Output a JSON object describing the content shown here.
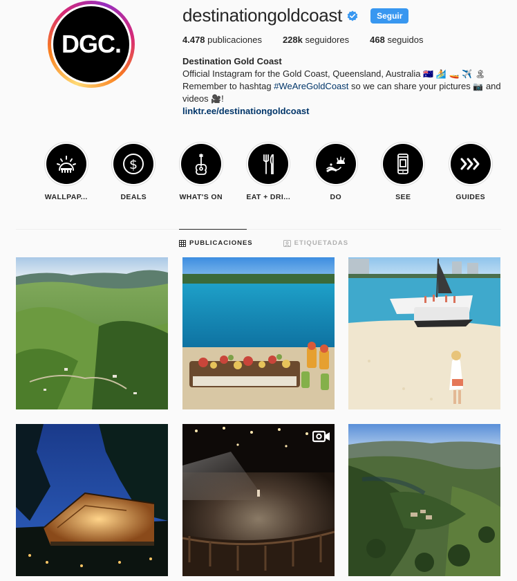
{
  "profile": {
    "avatar_text": "DGC.",
    "username": "destinationgoldcoast",
    "follow_label": "Seguir",
    "stats": {
      "posts_count": "4.478",
      "posts_label": "publicaciones",
      "followers_count": "228k",
      "followers_label": "seguidores",
      "following_count": "468",
      "following_label": "seguidos"
    },
    "bio": {
      "name": "Destination Gold Coast",
      "line1": "Official Instagram for the Gold Coast, Queensland, Australia",
      "line1_emojis": "🇦🇺 🏄 🚤 ✈️ 🏝",
      "line2_prefix": "Remember to hashtag",
      "hashtag": "#WeAreGoldCoast",
      "line2_suffix": "so we can share your pictures",
      "line2_emoji": "📷",
      "line2_end": "and",
      "line3": "videos",
      "line3_emoji": "🎥",
      "line3_end": "!",
      "link": "linktr.ee/destinationgoldcoast"
    }
  },
  "highlights": [
    {
      "label": "WALLPAP...",
      "icon": "sunrise-icon"
    },
    {
      "label": "DEALS",
      "icon": "dollar-icon"
    },
    {
      "label": "WHAT'S ON",
      "icon": "guitar-icon"
    },
    {
      "label": "EAT + DRI...",
      "icon": "fork-knife-icon"
    },
    {
      "label": "DO",
      "icon": "surf-icon"
    },
    {
      "label": "SEE",
      "icon": "phone-icon"
    },
    {
      "label": "GUIDES",
      "icon": "chevrons-icon"
    }
  ],
  "tabs": {
    "posts": "PUBLICACIONES",
    "tagged": "ETIQUETADAS"
  },
  "posts": [
    {
      "scene": "green hills landscape",
      "type": "photo"
    },
    {
      "scene": "beach picnic platter",
      "type": "photo"
    },
    {
      "scene": "catamaran on beach",
      "type": "photo"
    },
    {
      "scene": "glamping tent at night",
      "type": "photo"
    },
    {
      "scene": "night arena show",
      "type": "video"
    },
    {
      "scene": "forest valley aerial",
      "type": "photo"
    }
  ],
  "colors": {
    "accent": "#3897f0",
    "link": "#003569",
    "background": "#fafafa"
  }
}
